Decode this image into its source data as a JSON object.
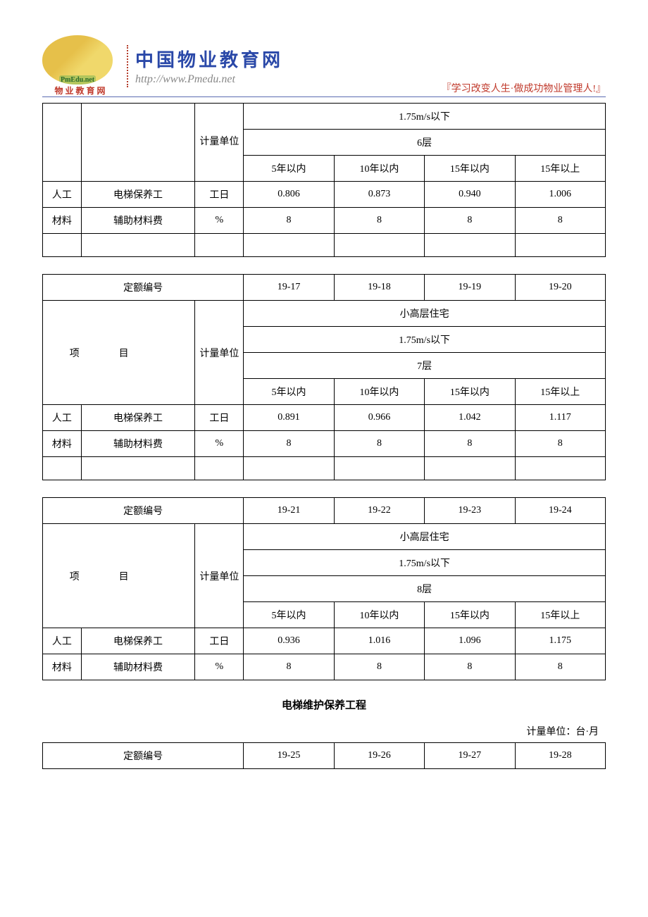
{
  "header": {
    "logo_text": "PmEdu.net",
    "logo_bottom": "物业教育网",
    "site_title": "中国物业教育网",
    "site_url": "http://www.Pmedu.net",
    "slogan": "『学习改变人生·做成功物业管理人!』"
  },
  "common": {
    "quota_code_label": "定额编号",
    "project_label": "项目",
    "unit_label": "计量单位",
    "labor_label": "人工",
    "material_label": "材料",
    "labor_item": "电梯保养工",
    "material_item": "辅助材料费",
    "unit_workday": "工日",
    "unit_percent": "%",
    "years": [
      "5年以内",
      "10年以内",
      "15年以内",
      "15年以上"
    ]
  },
  "section_title": "电梯维护保养工程",
  "unit_note": "计量单位：台·月",
  "tables": [
    {
      "partial_top": true,
      "spec1": "1.75m/s以下",
      "spec2": "6层",
      "labor_values": [
        "0.806",
        "0.873",
        "0.940",
        "1.006"
      ],
      "material_values": [
        "8",
        "8",
        "8",
        "8"
      ],
      "blank_row": true
    },
    {
      "codes": [
        "19-17",
        "19-18",
        "19-19",
        "19-20"
      ],
      "spec0": "小高层住宅",
      "spec1": "1.75m/s以下",
      "spec2": "7层",
      "labor_values": [
        "0.891",
        "0.966",
        "1.042",
        "1.117"
      ],
      "material_values": [
        "8",
        "8",
        "8",
        "8"
      ],
      "blank_row": true
    },
    {
      "codes": [
        "19-21",
        "19-22",
        "19-23",
        "19-24"
      ],
      "spec0": "小高层住宅",
      "spec1": "1.75m/s以下",
      "spec2": "8层",
      "labor_values": [
        "0.936",
        "1.016",
        "1.096",
        "1.175"
      ],
      "material_values": [
        "8",
        "8",
        "8",
        "8"
      ],
      "blank_row": false
    },
    {
      "codes": [
        "19-25",
        "19-26",
        "19-27",
        "19-28"
      ],
      "header_only": true
    }
  ],
  "chart_data": [
    {
      "type": "table",
      "title": "6层 1.75m/s以下",
      "categories": [
        "5年以内",
        "10年以内",
        "15年以内",
        "15年以上"
      ],
      "series": [
        {
          "name": "电梯保养工(工日)",
          "values": [
            0.806,
            0.873,
            0.94,
            1.006
          ]
        },
        {
          "name": "辅助材料费(%)",
          "values": [
            8,
            8,
            8,
            8
          ]
        }
      ]
    },
    {
      "type": "table",
      "title": "小高层住宅 7层 1.75m/s以下 (19-17~19-20)",
      "categories": [
        "5年以内",
        "10年以内",
        "15年以内",
        "15年以上"
      ],
      "series": [
        {
          "name": "电梯保养工(工日)",
          "values": [
            0.891,
            0.966,
            1.042,
            1.117
          ]
        },
        {
          "name": "辅助材料费(%)",
          "values": [
            8,
            8,
            8,
            8
          ]
        }
      ]
    },
    {
      "type": "table",
      "title": "小高层住宅 8层 1.75m/s以下 (19-21~19-24)",
      "categories": [
        "5年以内",
        "10年以内",
        "15年以内",
        "15年以上"
      ],
      "series": [
        {
          "name": "电梯保养工(工日)",
          "values": [
            0.936,
            1.016,
            1.096,
            1.175
          ]
        },
        {
          "name": "辅助材料费(%)",
          "values": [
            8,
            8,
            8,
            8
          ]
        }
      ]
    }
  ]
}
